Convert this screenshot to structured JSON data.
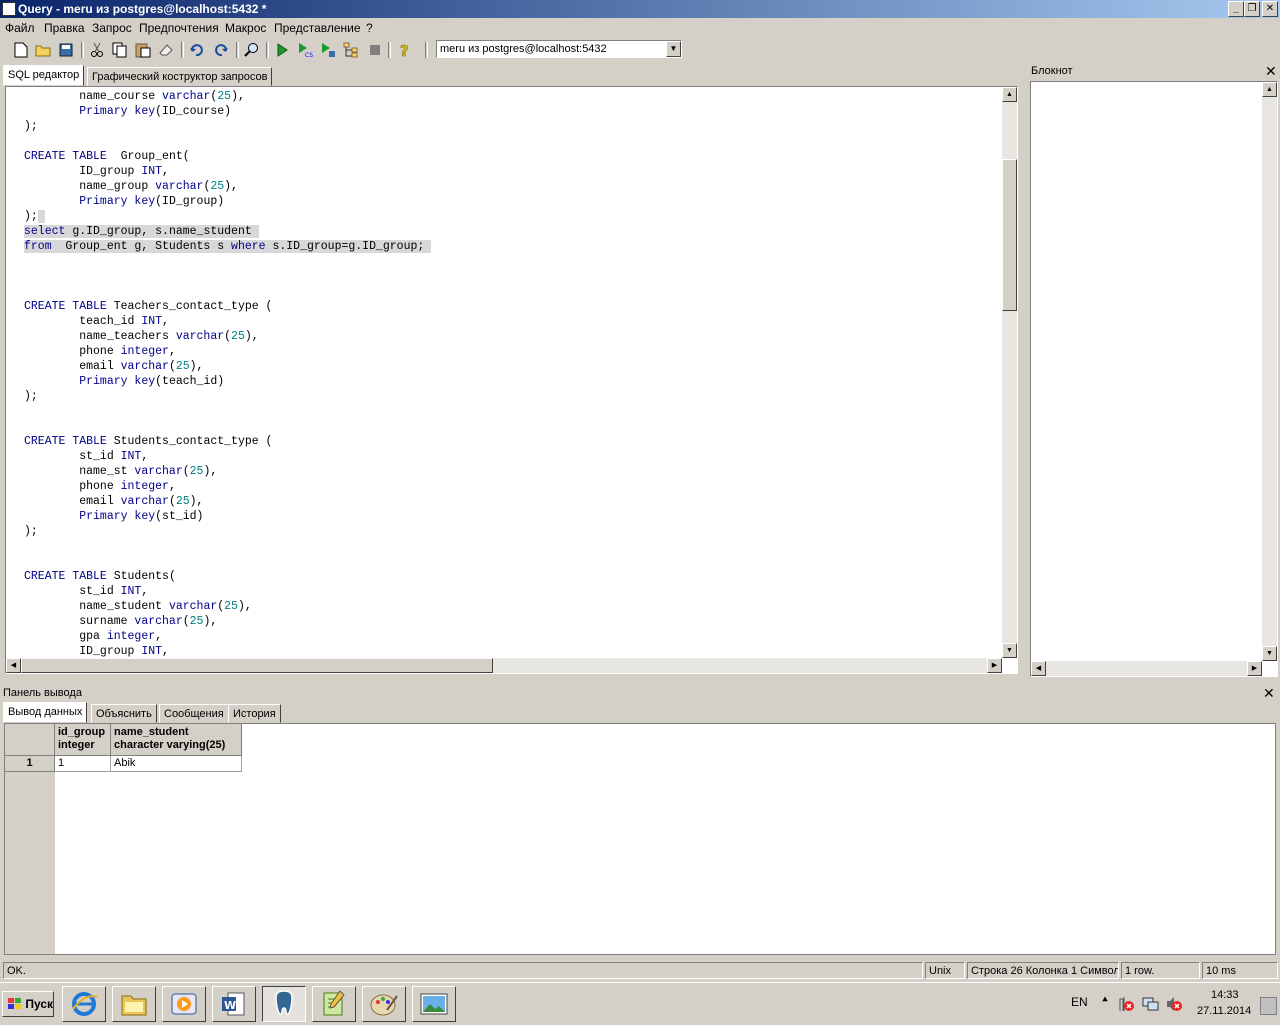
{
  "window": {
    "title": "Query - meru из postgres@localhost:5432 *",
    "minimize": "_",
    "maximize": "❐",
    "close": "✕"
  },
  "menu": [
    "Файл",
    "Правка",
    "Запрос",
    "Предпочтения",
    "Макрос",
    "Представление",
    "?"
  ],
  "toolbar": {
    "connection": "meru из postgres@localhost:5432"
  },
  "tabs": {
    "sql_editor": "SQL редактор",
    "graphical_builder": "Графический коструктор запросов"
  },
  "editor_lines": [
    {
      "t": [
        {
          "s": "        name_course "
        },
        {
          "s": "varchar",
          "c": "kw"
        },
        {
          "s": "("
        },
        {
          "s": "25",
          "c": "num"
        },
        {
          "s": "),"
        }
      ]
    },
    {
      "t": [
        {
          "s": "        "
        },
        {
          "s": "Primary key",
          "c": "kw"
        },
        {
          "s": "(ID_course)"
        }
      ]
    },
    {
      "t": [
        {
          "s": ");"
        }
      ]
    },
    {
      "t": [
        {
          "s": ""
        }
      ]
    },
    {
      "t": [
        {
          "s": "CREATE TABLE",
          "c": "kw"
        },
        {
          "s": "  Group_ent("
        }
      ]
    },
    {
      "t": [
        {
          "s": "        ID_group "
        },
        {
          "s": "INT",
          "c": "kw"
        },
        {
          "s": ","
        }
      ]
    },
    {
      "t": [
        {
          "s": "        name_group "
        },
        {
          "s": "varchar",
          "c": "kw"
        },
        {
          "s": "("
        },
        {
          "s": "25",
          "c": "num"
        },
        {
          "s": "),"
        }
      ]
    },
    {
      "t": [
        {
          "s": "        "
        },
        {
          "s": "Primary key",
          "c": "kw"
        },
        {
          "s": "(ID_group)"
        }
      ]
    },
    {
      "t": [
        {
          "s": ");"
        },
        {
          "s": " ",
          "sel": true
        }
      ]
    },
    {
      "sel": true,
      "t": [
        {
          "s": "select",
          "c": "kw"
        },
        {
          "s": " g.ID_group, s.name_student "
        }
      ]
    },
    {
      "sel": true,
      "t": [
        {
          "s": "from",
          "c": "kw"
        },
        {
          "s": "  Group_ent g, Students s "
        },
        {
          "s": "where",
          "c": "kw"
        },
        {
          "s": " s.ID_group=g.ID_group; "
        }
      ]
    },
    {
      "t": [
        {
          "s": ""
        }
      ]
    },
    {
      "t": [
        {
          "s": ""
        }
      ]
    },
    {
      "t": [
        {
          "s": ""
        }
      ]
    },
    {
      "t": [
        {
          "s": "CREATE TABLE",
          "c": "kw"
        },
        {
          "s": " Teachers_contact_type ("
        }
      ]
    },
    {
      "t": [
        {
          "s": "        teach_id "
        },
        {
          "s": "INT",
          "c": "kw"
        },
        {
          "s": ","
        }
      ]
    },
    {
      "t": [
        {
          "s": "        name_teachers "
        },
        {
          "s": "varchar",
          "c": "kw"
        },
        {
          "s": "("
        },
        {
          "s": "25",
          "c": "num"
        },
        {
          "s": "),"
        }
      ]
    },
    {
      "t": [
        {
          "s": "        phone "
        },
        {
          "s": "integer",
          "c": "kw"
        },
        {
          "s": ","
        }
      ]
    },
    {
      "t": [
        {
          "s": "        email "
        },
        {
          "s": "varchar",
          "c": "kw"
        },
        {
          "s": "("
        },
        {
          "s": "25",
          "c": "num"
        },
        {
          "s": "),"
        }
      ]
    },
    {
      "t": [
        {
          "s": "        "
        },
        {
          "s": "Primary key",
          "c": "kw"
        },
        {
          "s": "(teach_id)"
        }
      ]
    },
    {
      "t": [
        {
          "s": ");"
        }
      ]
    },
    {
      "t": [
        {
          "s": ""
        }
      ]
    },
    {
      "t": [
        {
          "s": ""
        }
      ]
    },
    {
      "t": [
        {
          "s": "CREATE TABLE",
          "c": "kw"
        },
        {
          "s": " Students_contact_type ("
        }
      ]
    },
    {
      "t": [
        {
          "s": "        st_id "
        },
        {
          "s": "INT",
          "c": "kw"
        },
        {
          "s": ","
        }
      ]
    },
    {
      "t": [
        {
          "s": "        name_st "
        },
        {
          "s": "varchar",
          "c": "kw"
        },
        {
          "s": "("
        },
        {
          "s": "25",
          "c": "num"
        },
        {
          "s": "),"
        }
      ]
    },
    {
      "t": [
        {
          "s": "        phone "
        },
        {
          "s": "integer",
          "c": "kw"
        },
        {
          "s": ","
        }
      ]
    },
    {
      "t": [
        {
          "s": "        email "
        },
        {
          "s": "varchar",
          "c": "kw"
        },
        {
          "s": "("
        },
        {
          "s": "25",
          "c": "num"
        },
        {
          "s": "),"
        }
      ]
    },
    {
      "t": [
        {
          "s": "        "
        },
        {
          "s": "Primary key",
          "c": "kw"
        },
        {
          "s": "(st_id)"
        }
      ]
    },
    {
      "t": [
        {
          "s": ");"
        }
      ]
    },
    {
      "t": [
        {
          "s": ""
        }
      ]
    },
    {
      "t": [
        {
          "s": ""
        }
      ]
    },
    {
      "t": [
        {
          "s": "CREATE TABLE",
          "c": "kw"
        },
        {
          "s": " Students("
        }
      ]
    },
    {
      "t": [
        {
          "s": "        st_id "
        },
        {
          "s": "INT",
          "c": "kw"
        },
        {
          "s": ","
        }
      ]
    },
    {
      "t": [
        {
          "s": "        name_student "
        },
        {
          "s": "varchar",
          "c": "kw"
        },
        {
          "s": "("
        },
        {
          "s": "25",
          "c": "num"
        },
        {
          "s": "),"
        }
      ]
    },
    {
      "t": [
        {
          "s": "        surname "
        },
        {
          "s": "varchar",
          "c": "kw"
        },
        {
          "s": "("
        },
        {
          "s": "25",
          "c": "num"
        },
        {
          "s": "),"
        }
      ]
    },
    {
      "t": [
        {
          "s": "        gpa "
        },
        {
          "s": "integer",
          "c": "kw"
        },
        {
          "s": ","
        }
      ]
    },
    {
      "t": [
        {
          "s": "        ID_group "
        },
        {
          "s": "INT",
          "c": "kw"
        },
        {
          "s": ","
        }
      ]
    }
  ],
  "notepad": {
    "title": "Блокнот"
  },
  "output": {
    "title": "Панель вывода",
    "tabs": [
      "Вывод данных",
      "Объяснить",
      "Сообщения",
      "История"
    ],
    "columns": [
      {
        "name": "id_group",
        "type": "integer"
      },
      {
        "name": "name_student",
        "type": "character varying(25)"
      }
    ],
    "rows": [
      {
        "num": "1",
        "cells": [
          "1",
          "Abik"
        ]
      }
    ]
  },
  "status": {
    "message": "OK.",
    "line_ending": "Unix",
    "position": "Строка 26 Колонка 1 Символ",
    "rows": "1 row.",
    "time": "10 ms"
  },
  "taskbar": {
    "start": "Пуск",
    "lang": "EN",
    "time": "14:33",
    "date": "27.11.2014"
  }
}
